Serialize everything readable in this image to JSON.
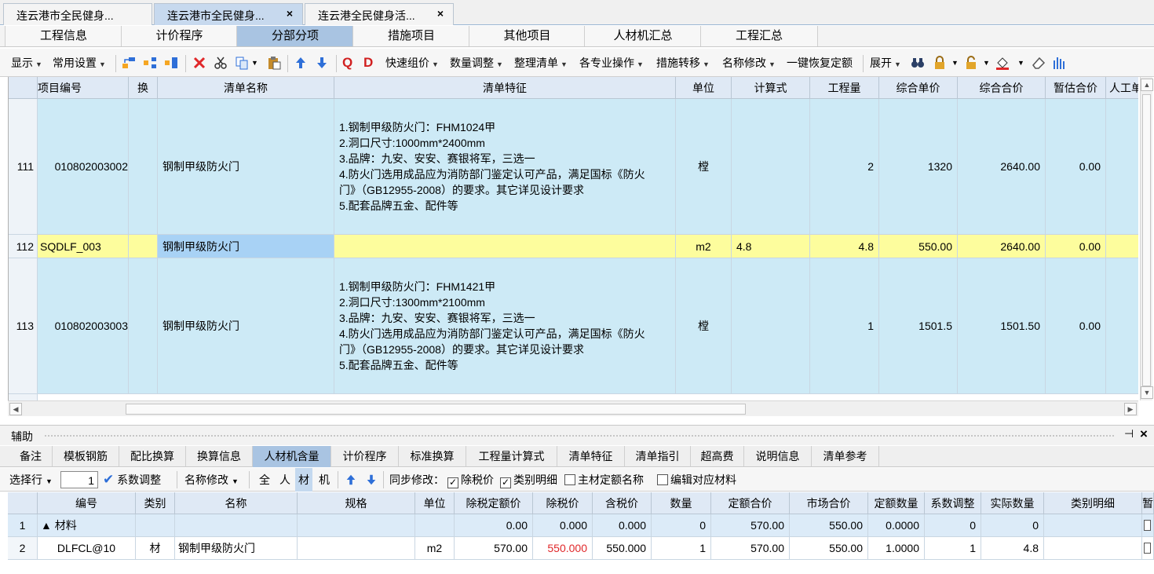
{
  "doc_tabs": [
    {
      "label": "连云港市全民健身..."
    },
    {
      "label": "连云港市全民健身...",
      "close": "×"
    },
    {
      "label": "连云港全民健身活...",
      "close": "×"
    }
  ],
  "module_tabs": [
    "工程信息",
    "计价程序",
    "分部分项",
    "措施项目",
    "其他项目",
    "人材机汇总",
    "工程汇总"
  ],
  "toolbar": {
    "display": "显示",
    "common_settings": "常用设置",
    "quick_group_price": "快速组价",
    "quantity_adjust": "数量调整",
    "organize_list": "整理清单",
    "specialty_ops": "各专业操作",
    "measure_transfer": "措施转移",
    "rename": "名称修改",
    "restore_quota": "一键恢复定额",
    "expand": "展开",
    "q_label": "Q",
    "d_label": "D"
  },
  "main_grid": {
    "headers": [
      "项目编号",
      "换",
      "清单名称",
      "清单特征",
      "单位",
      "计算式",
      "工程量",
      "综合单价",
      "综合合价",
      "暂估合价",
      "人工单"
    ],
    "rows": [
      {
        "num": "111",
        "code": "010802003002",
        "name": "钢制甲级防火门",
        "features": "1.钢制甲级防火门：FHM1024甲\n2.洞口尺寸:1000mm*2400mm\n3.品牌：九安、安安、赛银将军，三选一\n4.防火门选用成品应为消防部门鉴定认可产品，满足国标《防火\n门》（GB12955-2008）的要求。其它详见设计要求\n5.配套品牌五金、配件等",
        "unit": "樘",
        "formula": "",
        "qty": "2",
        "unit_price": "1320",
        "total": "2640.00",
        "est_total": "0.00"
      },
      {
        "num": "112",
        "code": "SQDLF_003",
        "name": "钢制甲级防火门",
        "features": "",
        "unit": "m2",
        "formula": "4.8",
        "qty": "4.8",
        "unit_price": "550.00",
        "total": "2640.00",
        "est_total": "0.00"
      },
      {
        "num": "113",
        "code": "010802003003",
        "name": "钢制甲级防火门",
        "features": "1.钢制甲级防火门：FHM1421甲\n2.洞口尺寸:1300mm*2100mm\n3.品牌：九安、安安、赛银将军，三选一\n4.防火门选用成品应为消防部门鉴定认可产品，满足国标《防火\n门》（GB12955-2008）的要求。其它详见设计要求\n5.配套品牌五金、配件等",
        "unit": "樘",
        "formula": "",
        "qty": "1",
        "unit_price": "1501.5",
        "total": "1501.50",
        "est_total": "0.00"
      }
    ]
  },
  "assist": {
    "title": "辅助",
    "pin": "⊣",
    "close": "×",
    "tabs": [
      "备注",
      "模板钢筋",
      "配比换算",
      "换算信息",
      "人材机含量",
      "计价程序",
      "标准换算",
      "工程量计算式",
      "清单特征",
      "清单指引",
      "超高费",
      "说明信息",
      "清单参考"
    ],
    "toolbar": {
      "select_row": "选择行",
      "stepper_value": "1",
      "coef_adjust": "系数调整",
      "rename": "名称修改",
      "filter_all": "全",
      "filter_labor": "人",
      "filter_material": "材",
      "filter_machine": "机",
      "sync_label": "同步修改：",
      "chk_tax_excl_price": "除税价",
      "chk_category_detail": "类别明细",
      "chk_main_material_name": "主材定额名称",
      "chk_edit_material": "编辑对应材料"
    },
    "headers": [
      "编号",
      "类别",
      "名称",
      "规格",
      "单位",
      "除税定额价",
      "除税价",
      "含税价",
      "数量",
      "定额合价",
      "市场合价",
      "定额数量",
      "系数调整",
      "实际数量",
      "类别明细",
      "暂"
    ],
    "rows": [
      {
        "idx": "1",
        "code": "▲ 材料",
        "cat": "",
        "name": "",
        "spec": "",
        "unit": "",
        "quota_price": "0.00",
        "tax_excl": "0.000",
        "tax_incl": "0.000",
        "qty": "0",
        "quota_total": "570.00",
        "market_total": "550.00",
        "quota_qty": "0.0000",
        "coef": "0",
        "actual_qty": "0",
        "cat_detail": ""
      },
      {
        "idx": "2",
        "code": "DLFCL@10",
        "cat": "材",
        "name": "钢制甲级防火门",
        "spec": "",
        "unit": "m2",
        "quota_price": "570.00",
        "tax_excl": "550.000",
        "tax_incl": "550.000",
        "qty": "1",
        "quota_total": "570.00",
        "market_total": "550.00",
        "quota_qty": "1.0000",
        "coef": "1",
        "actual_qty": "4.8",
        "cat_detail": ""
      }
    ]
  },
  "colors": {
    "active_tab": "#a9c4e2",
    "row_blue": "#cdeaf6",
    "row_yellow": "#fdfd9d",
    "red_value": "#e0282a"
  }
}
